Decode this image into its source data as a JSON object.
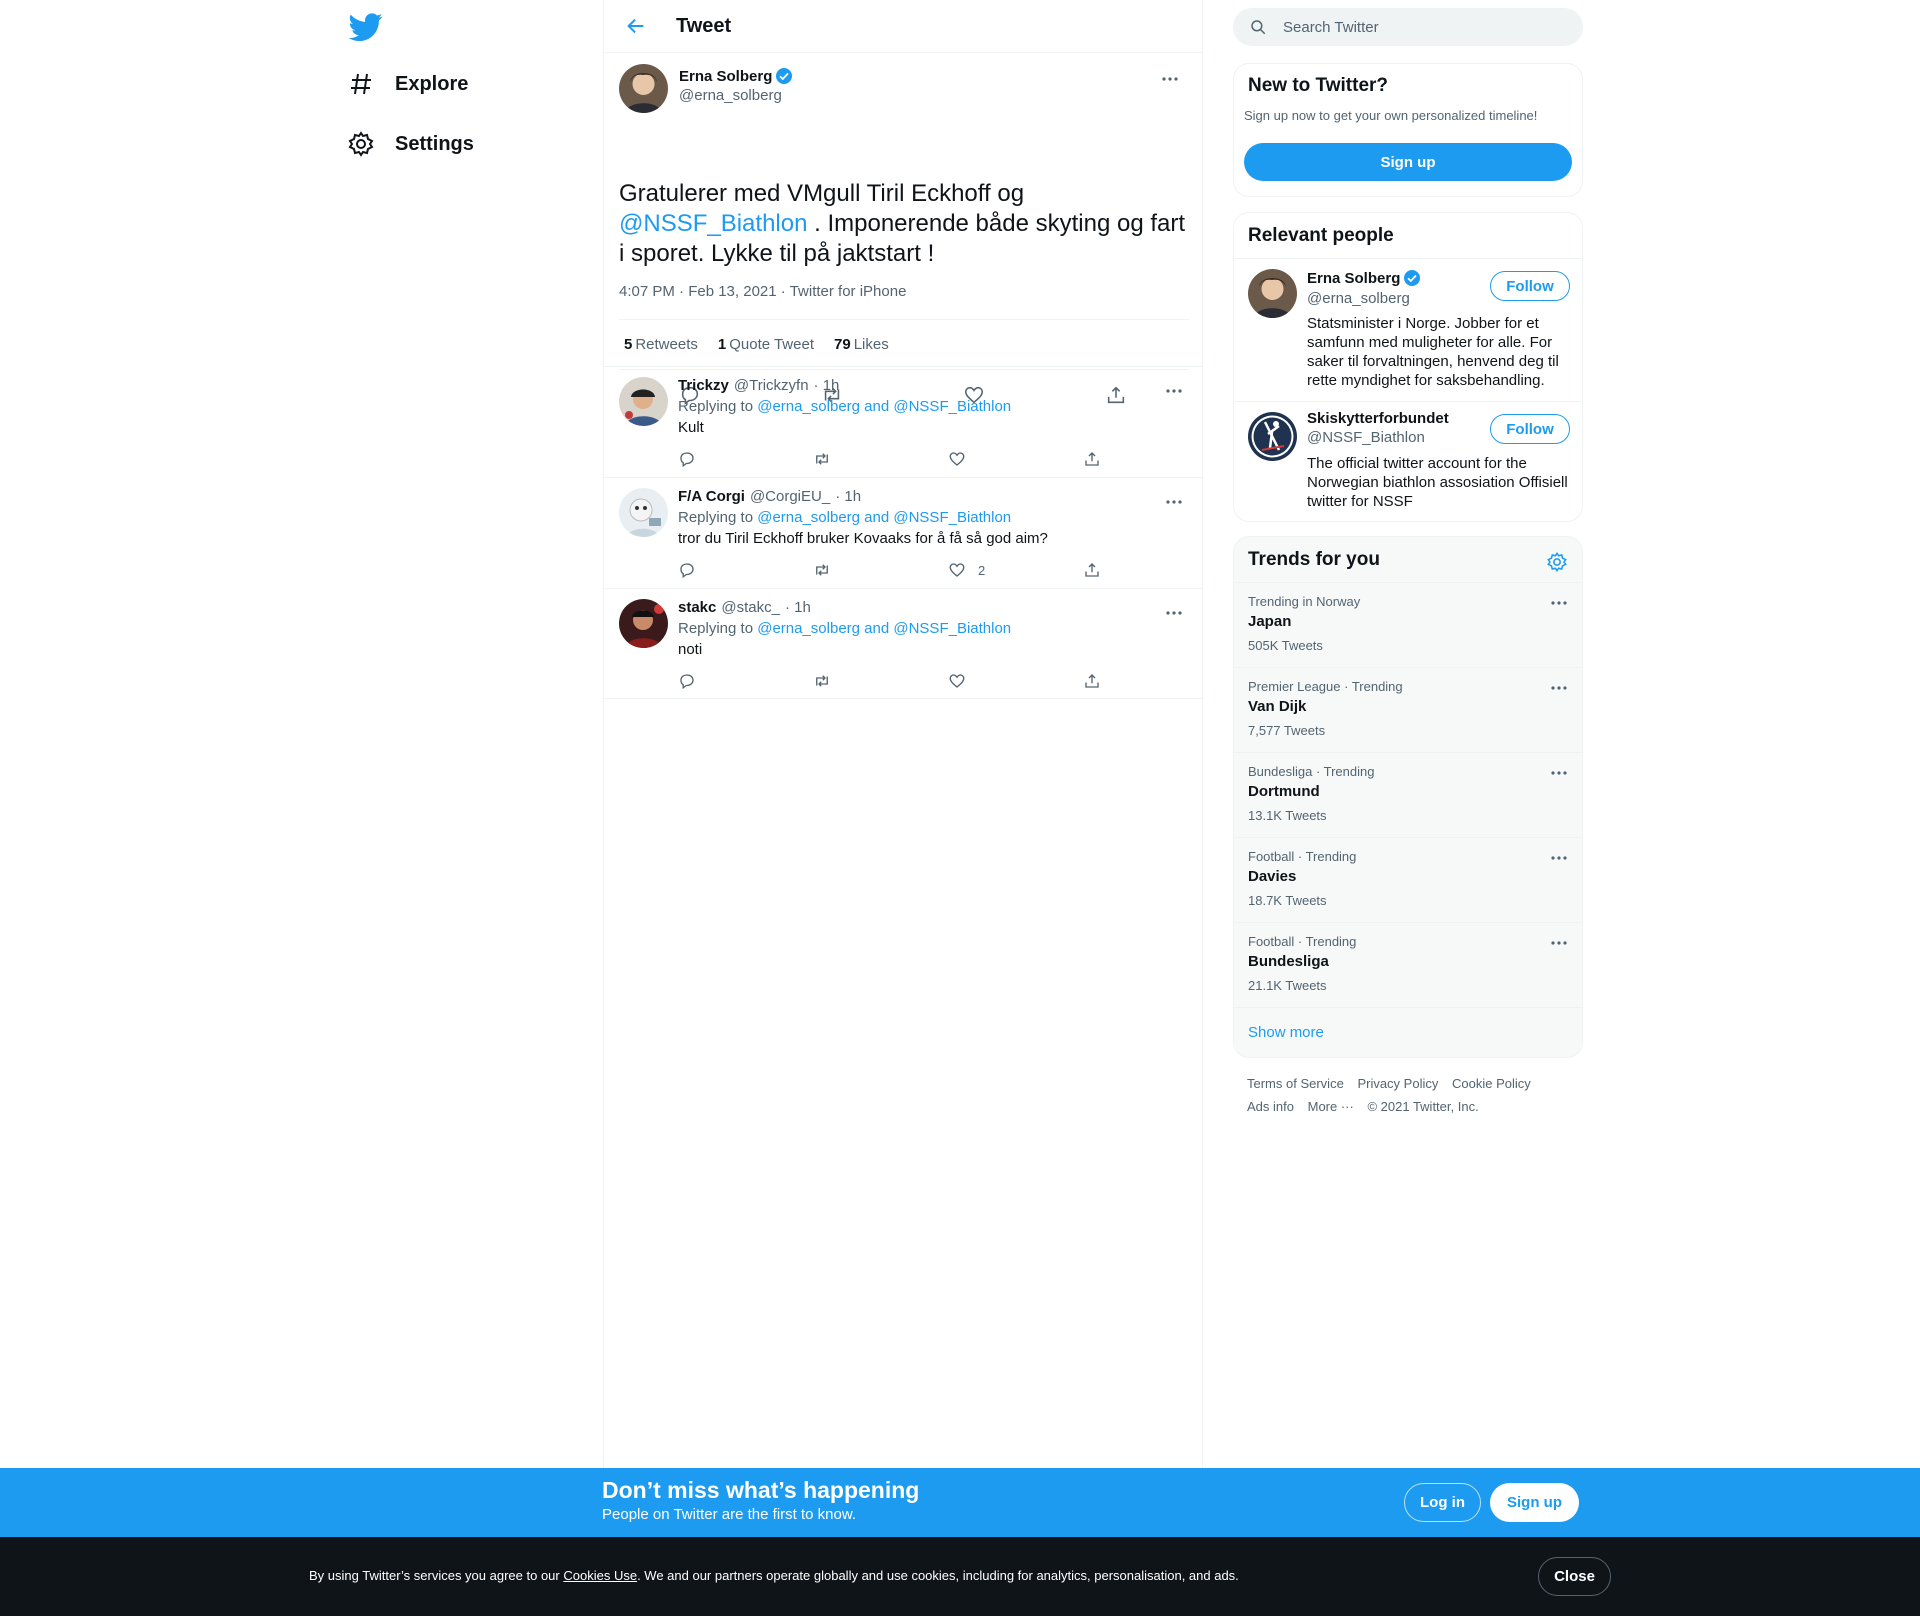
{
  "nav": {
    "items": [
      {
        "label": "Explore",
        "icon": "hashtag-icon"
      },
      {
        "label": "Settings",
        "icon": "gear-icon"
      }
    ]
  },
  "header": {
    "title": "Tweet"
  },
  "tweet": {
    "author": {
      "name": "Erna Solberg",
      "handle": "@erna_solberg",
      "verified": true
    },
    "text_before": "Gratulerer med VMgull Tiril Eckhoff og ",
    "mention": "@NSSF_Biathlon",
    "text_after": " . Imponerende både skyting og fart i sporet. Lykke til på jaktstart !",
    "timestamp": "4:07 PM · Feb 13, 2021",
    "source": "Twitter for iPhone",
    "stats": {
      "retweets": "5",
      "retweets_label": "Retweets",
      "quotes": "1",
      "quotes_label": "Quote Tweet",
      "likes": "79",
      "likes_label": "Likes"
    }
  },
  "replies": [
    {
      "name": "Trickzy",
      "handle": "@Trickzyfn",
      "time": "· 1h",
      "replying_prefix": "Replying to",
      "replying_to": "@erna_solberg and @NSSF_Biathlon",
      "text": "Kult",
      "like_count": ""
    },
    {
      "name": "F/A Corgi",
      "handle": "@CorgiEU_",
      "time": "· 1h",
      "replying_prefix": "Replying to",
      "replying_to": "@erna_solberg and @NSSF_Biathlon",
      "text": "tror du Tiril Eckhoff bruker Kovaaks for å få så god aim?",
      "like_count": "2"
    },
    {
      "name": "stakc",
      "handle": "@stakc_",
      "time": "· 1h",
      "replying_prefix": "Replying to",
      "replying_to": "@erna_solberg and @NSSF_Biathlon",
      "text": "noti",
      "like_count": ""
    }
  ],
  "search": {
    "placeholder": "Search Twitter"
  },
  "new_to_twitter": {
    "title": "New to Twitter?",
    "subtitle": "Sign up now to get your own personalized timeline!",
    "button": "Sign up"
  },
  "relevant_people": {
    "title": "Relevant people",
    "people": [
      {
        "name": "Erna Solberg",
        "handle": "@erna_solberg",
        "verified": true,
        "follow": "Follow",
        "bio": "Statsminister i Norge. Jobber for et samfunn med muligheter for alle. For saker til forvaltningen, henvend deg til rette myndighet for saksbehandling."
      },
      {
        "name": "Skiskytterforbundet",
        "handle": "@NSSF_Biathlon",
        "verified": false,
        "follow": "Follow",
        "bio": "The official twitter account for the Norwegian biathlon assosiation Offisiell twitter for NSSF"
      }
    ]
  },
  "trends": {
    "title": "Trends for you",
    "items": [
      {
        "context": "Trending in Norway",
        "name": "Japan",
        "count": "505K Tweets"
      },
      {
        "context": "Premier League · Trending",
        "name": "Van Dijk",
        "count": "7,577 Tweets"
      },
      {
        "context": "Bundesliga · Trending",
        "name": "Dortmund",
        "count": "13.1K Tweets"
      },
      {
        "context": "Football · Trending",
        "name": "Davies",
        "count": "18.7K Tweets"
      },
      {
        "context": "Football · Trending",
        "name": "Bundesliga",
        "count": "21.1K Tweets"
      }
    ],
    "show_more": "Show more"
  },
  "footer": {
    "terms": "Terms of Service",
    "privacy": "Privacy Policy",
    "cookie": "Cookie Policy",
    "ads": "Ads info",
    "more": "More ···",
    "copyright": "© 2021 Twitter, Inc."
  },
  "banner": {
    "title": "Don’t miss what’s happening",
    "subtitle": "People on Twitter are the first to know.",
    "login": "Log in",
    "signup": "Sign up"
  },
  "cookie_bar": {
    "text_before": "By using Twitter’s services you agree to our ",
    "link": "Cookies Use",
    "text_after": ". We and our partners operate globally and use cookies, including for analytics, personalisation, and ads.",
    "close": "Close"
  },
  "colors": {
    "accent": "#1d9bf0",
    "text": "#0f1419",
    "muted": "#536471",
    "cookie_bg": "#0f1419"
  }
}
